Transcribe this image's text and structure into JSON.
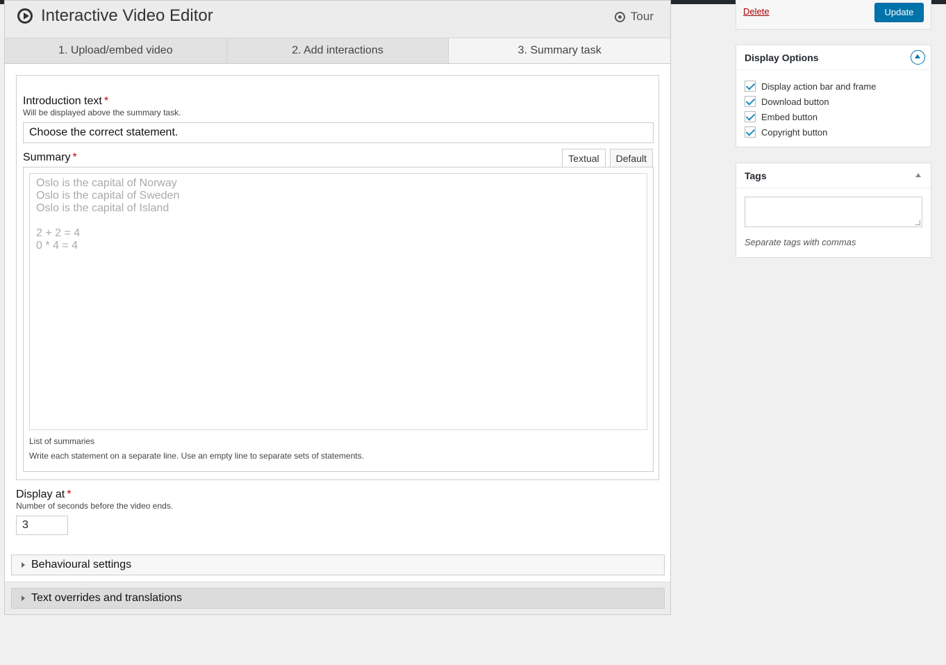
{
  "editor": {
    "title": "Interactive Video Editor",
    "tour_label": "Tour",
    "tabs": [
      {
        "label": "1. Upload/embed video",
        "active": false
      },
      {
        "label": "2. Add interactions",
        "active": false
      },
      {
        "label": "3. Summary task",
        "active": true
      }
    ]
  },
  "intro": {
    "label": "Introduction text",
    "required": "*",
    "description": "Will be displayed above the summary task.",
    "value": "Choose the correct statement."
  },
  "summary": {
    "label": "Summary",
    "required": "*",
    "mode_tabs": [
      "Textual",
      "Default"
    ],
    "active_mode": "Textual",
    "text": "Oslo is the capital of Norway\nOslo is the capital of Sweden\nOslo is the capital of Island\n\n2 + 2 = 4\n0 * 4 = 4",
    "list_note": "List of summaries",
    "help": "Write each statement on a separate line. Use an empty line to separate sets of statements."
  },
  "display_at": {
    "label": "Display at",
    "required": "*",
    "description": "Number of seconds before the video ends.",
    "value": "3"
  },
  "accordions": {
    "behavioural": "Behavioural settings",
    "overrides": "Text overrides and translations"
  },
  "publish": {
    "delete_label": "Delete",
    "update_label": "Update"
  },
  "display_options": {
    "title": "Display Options",
    "items": [
      {
        "label": "Display action bar and frame",
        "checked": true
      },
      {
        "label": "Download button",
        "checked": true
      },
      {
        "label": "Embed button",
        "checked": true
      },
      {
        "label": "Copyright button",
        "checked": true
      }
    ]
  },
  "tags": {
    "title": "Tags",
    "note": "Separate tags with commas"
  },
  "colors": {
    "accent": "#0073aa",
    "required": "#cc0000",
    "delete": "#aa0000"
  }
}
